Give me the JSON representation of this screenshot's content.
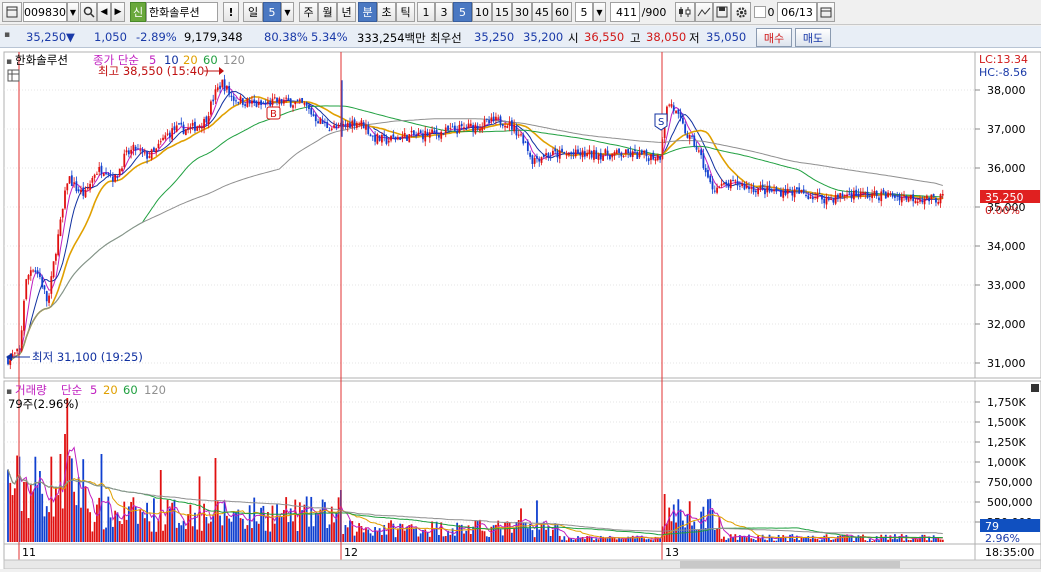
{
  "toolbar": {
    "code": "009830",
    "badge": "신",
    "stock_name": "한화솔루션",
    "alert": "!",
    "period_day": "일",
    "period_num": "5",
    "week": "주",
    "month": "월",
    "year": "년",
    "minute": "분",
    "second": "초",
    "tick": "틱",
    "intervals": [
      "1",
      "3",
      "5",
      "10",
      "15",
      "30",
      "45",
      "60"
    ],
    "count": "5",
    "bars": "411",
    "bars_total": "/900",
    "check_label": "0",
    "date": "06/13"
  },
  "quote": {
    "price": "35,250",
    "arrow": "▼",
    "change": "1,050",
    "change_pct": "-2.89%",
    "volume": "9,179,348",
    "ratio1": "80.38%",
    "ratio2": "5.34%",
    "amount": "333,254백만",
    "best_label": "최우선",
    "best_ask": "35,250",
    "best_bid": "35,200",
    "open_label": "시",
    "open": "36,550",
    "high_label": "고",
    "high": "38,050",
    "low_label": "저",
    "low": "35,050",
    "buy": "매수",
    "sell": "매도"
  },
  "price_panel": {
    "name": "한화솔루션",
    "ma_label": "종가 단순",
    "ma_periods": [
      "5",
      "10",
      "20",
      "60",
      "120"
    ],
    "max_label": "최고 38,550 (15:40)",
    "min_label": "최저 31,100 (19:25)",
    "lc": "LC:13.34",
    "hc": "HC:-8.56",
    "current_price": "35,250",
    "current_pct": "0.00%",
    "marker_b": "B",
    "marker_s": "S",
    "y_ticks": [
      "38,000",
      "37,000",
      "36,000",
      "35,000",
      "34,000",
      "33,000",
      "32,000",
      "31,000"
    ]
  },
  "volume_panel": {
    "name": "거래량",
    "ma_label": "단순",
    "ma_periods": [
      "5",
      "20",
      "60",
      "120"
    ],
    "last_label": "79주(2.96%)",
    "current_vol": "79",
    "current_pct": "2.96%",
    "y_ticks": [
      "1,750K",
      "1,500K",
      "1,250K",
      "1,000K",
      "750,000",
      "500,000",
      "250,000"
    ]
  },
  "x_axis": {
    "labels": [
      "11",
      "12",
      "13"
    ],
    "time": "18:35:00"
  },
  "colors": {
    "up": "#e01010",
    "down": "#1040d0",
    "ma5": "#c020c0",
    "ma10": "#1030a0",
    "ma20": "#e0a000",
    "ma60": "#20a040",
    "ma120": "#909090"
  }
}
